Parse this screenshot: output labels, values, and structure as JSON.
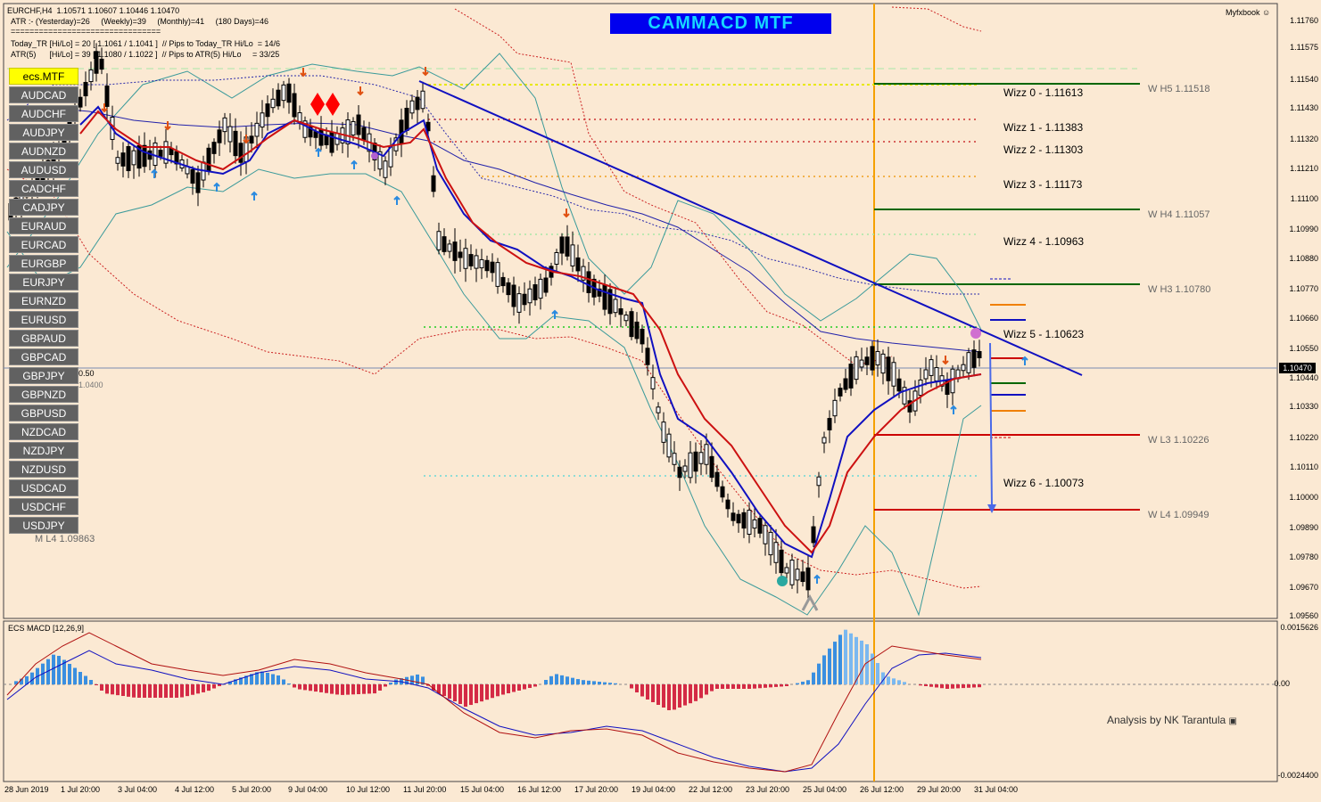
{
  "window": {
    "symbol_line": "EURCHF,H4  1.10571 1.10607 1.10446 1.10470",
    "atr_line": "ATR :- (Yesterday)=26     (Weekly)=39     (Monthly)=41     (180 Days)=46",
    "separator": "================================",
    "today_tr_line": "Today_TR [Hi/Lo] = 20 [ 1.1061 / 1.1041 ]  // Pips to Today_TR Hi/Lo  = 14/6",
    "atr5_line": "ATR(5)      [Hi/Lo] = 39 [ 1.1080 / 1.1022 ]  // Pips to ATR(5) Hi/Lo     = 33/25",
    "brand": "Myfxbook"
  },
  "banner": {
    "title": "CAMMACD MTF"
  },
  "pairs": {
    "active": "ecs.MTF",
    "items": [
      "AUDCAD",
      "AUDCHF",
      "AUDJPY",
      "AUDNZD",
      "AUDUSD",
      "CADCHF",
      "CADJPY",
      "EURAUD",
      "EURCAD",
      "EURGBP",
      "EURJPY",
      "EURNZD",
      "EURUSD",
      "GBPAUD",
      "GBPCAD",
      "GBPJPY",
      "GBPNZD",
      "GBPUSD",
      "NZDCAD",
      "NZDJPY",
      "NZDUSD",
      "USDCAD",
      "USDCHF",
      "USDJPY"
    ]
  },
  "levels": {
    "wizz": [
      {
        "label": "Wizz 0 - 1.11613",
        "color": "#ffff00"
      },
      {
        "label": "Wizz 1 - 1.11383",
        "color": "#cc2222"
      },
      {
        "label": "Wizz 2 - 1.11303",
        "color": "#cc2222"
      },
      {
        "label": "Wizz 3 - 1.11173",
        "color": "#f0a020"
      },
      {
        "label": "Wizz 4 - 1.10963",
        "color": "#a8e8a8"
      },
      {
        "label": "Wizz 5 - 1.10623",
        "color": "#22dd22"
      },
      {
        "label": "Wizz 6 - 1.10073",
        "color": "#6ad8d8"
      }
    ],
    "pivots": [
      "W  H5 1.11518",
      "W  H4 1.11057",
      "W  H3 1.10780",
      "W  L3 1.10226",
      "W  L4 1.09949"
    ],
    "monthly_label": "M  L4 1.09863",
    "left_partial": [
      "0.50",
      "1.0400"
    ]
  },
  "price_axis": {
    "labels": [
      "1.11760",
      "1.11575",
      "1.11540",
      "1.11430",
      "1.11320",
      "1.11210",
      "1.11100",
      "1.10990",
      "1.10880",
      "1.10770",
      "1.10660",
      "1.10550",
      "1.10440",
      "1.10330",
      "1.10220",
      "1.10110",
      "1.10000",
      "1.09890",
      "1.09780",
      "1.09670",
      "1.09560"
    ],
    "current": "1.10470"
  },
  "time_axis": {
    "labels": [
      "28 Jun 2019",
      "1 Jul 20:00",
      "3 Jul 04:00",
      "4 Jul 12:00",
      "5 Jul 20:00",
      "9 Jul 04:00",
      "10 Jul 12:00",
      "11 Jul 20:00",
      "15 Jul 04:00",
      "16 Jul 12:00",
      "17 Jul 20:00",
      "19 Jul 04:00",
      "22 Jul 12:00",
      "23 Jul 20:00",
      "25 Jul 04:00",
      "26 Jul 12:00",
      "29 Jul 20:00",
      "31 Jul 04:00"
    ]
  },
  "indicator": {
    "name": "ECS MACD [12,26,9]",
    "axis_labels": [
      "0.0015626",
      "0.00",
      "-0.0024400"
    ],
    "credit": "Analysis by NK Tarantula"
  },
  "colors": {
    "background": "#fbe9d3",
    "bull_hist": "#3a8fe0",
    "bear_hist": "#d42a45",
    "trendline": "#1010c0",
    "vertical_marker": "#f5a000"
  }
}
